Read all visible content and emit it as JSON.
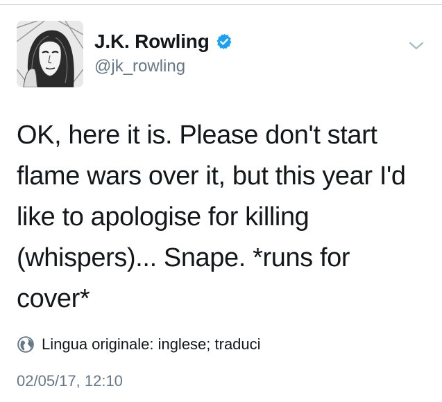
{
  "tweet": {
    "author": {
      "display_name": "J.K. Rowling",
      "handle": "@jk_rowling",
      "verified": true,
      "avatar_icon": "profile-photo",
      "verified_icon": "verified-badge-icon"
    },
    "menu_icon": "chevron-down-icon",
    "text": "OK, here it is. Please don't start flame wars over it, but this year I'd like to apologise for killing (whispers)... Snape. *runs for cover*",
    "translation_notice": {
      "icon": "globe-icon",
      "text": "Lingua originale: inglese; traduci"
    },
    "timestamp": "02/05/17, 12:10"
  },
  "colors": {
    "text_primary": "#14171a",
    "text_secondary": "#657786",
    "verified_blue": "#1da1f2",
    "divider": "#d8dde2"
  }
}
